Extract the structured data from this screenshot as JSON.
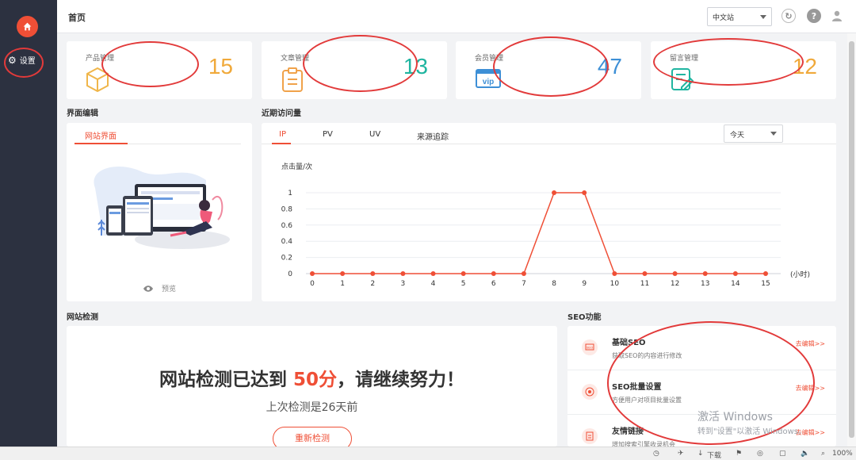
{
  "sidebar": {
    "home_icon": "home-icon",
    "settings_label": "设置",
    "settings_icon": "gear-icon"
  },
  "header": {
    "title": "首页",
    "site_select": "中文站",
    "icons": [
      "refresh-icon",
      "help-icon",
      "user-icon"
    ]
  },
  "stats": [
    {
      "label": "产品管理",
      "value": "15",
      "icon": "box-icon",
      "color": "#f0a93a"
    },
    {
      "label": "文章管理",
      "value": "13",
      "icon": "clipboard-icon",
      "color": "#1fb5a0"
    },
    {
      "label": "会员管理",
      "value": "47",
      "icon": "vip-card-icon",
      "color": "#3d8fd6"
    },
    {
      "label": "留言管理",
      "value": "12",
      "icon": "message-edit-icon",
      "color": "#f0a93a"
    }
  ],
  "ui_edit": {
    "section_title": "界面编辑",
    "tab": "网站界面",
    "preview_label": "预览"
  },
  "visits": {
    "section_title": "近期访问量",
    "tabs": [
      "IP",
      "PV",
      "UV",
      "来源追踪"
    ],
    "period": "今天",
    "ylabel": "点击量/次",
    "xunit": "(小时)"
  },
  "chart_data": {
    "type": "line",
    "x": [
      0,
      1,
      2,
      3,
      4,
      5,
      6,
      7,
      8,
      9,
      10,
      11,
      12,
      13,
      14,
      15
    ],
    "y_ticks": [
      "0",
      "0.2",
      "0.4",
      "0.6",
      "0.8",
      "1"
    ],
    "series": [
      {
        "values": [
          0,
          0,
          0,
          0,
          0,
          0,
          0,
          0,
          1,
          1,
          0,
          0,
          0,
          0,
          0,
          0
        ],
        "color": "#ef4f36"
      }
    ],
    "ylim": [
      0,
      1
    ],
    "xlabel": "(小时)",
    "ylabel": "点击量/次",
    "grid": true
  },
  "detection": {
    "section_title": "网站检测",
    "title_prefix": "网站检测已达到 ",
    "score": "50分",
    "title_suffix": "，请继续努力！",
    "subtitle": "上次检测是26天前",
    "button": "重新检测"
  },
  "seo": {
    "section_title": "SEO功能",
    "items": [
      {
        "title": "基础SEO",
        "desc": "获取SEO的内容进行修改",
        "link": "去编辑>>",
        "icon": "seo-icon"
      },
      {
        "title": "SEO批量设置",
        "desc": "方便用户对项目批量设置",
        "link": "去编辑>>",
        "icon": "target-icon"
      },
      {
        "title": "友情链接",
        "desc": "增加搜索引擎收录机会",
        "link": "去编辑>>",
        "icon": "link-doc-icon"
      }
    ]
  },
  "watermark": {
    "line1": "激活 Windows",
    "line2": "转到\"设置\"以激活 Windows。"
  },
  "statusbar": {
    "download": "下载",
    "zoom": "100%"
  }
}
